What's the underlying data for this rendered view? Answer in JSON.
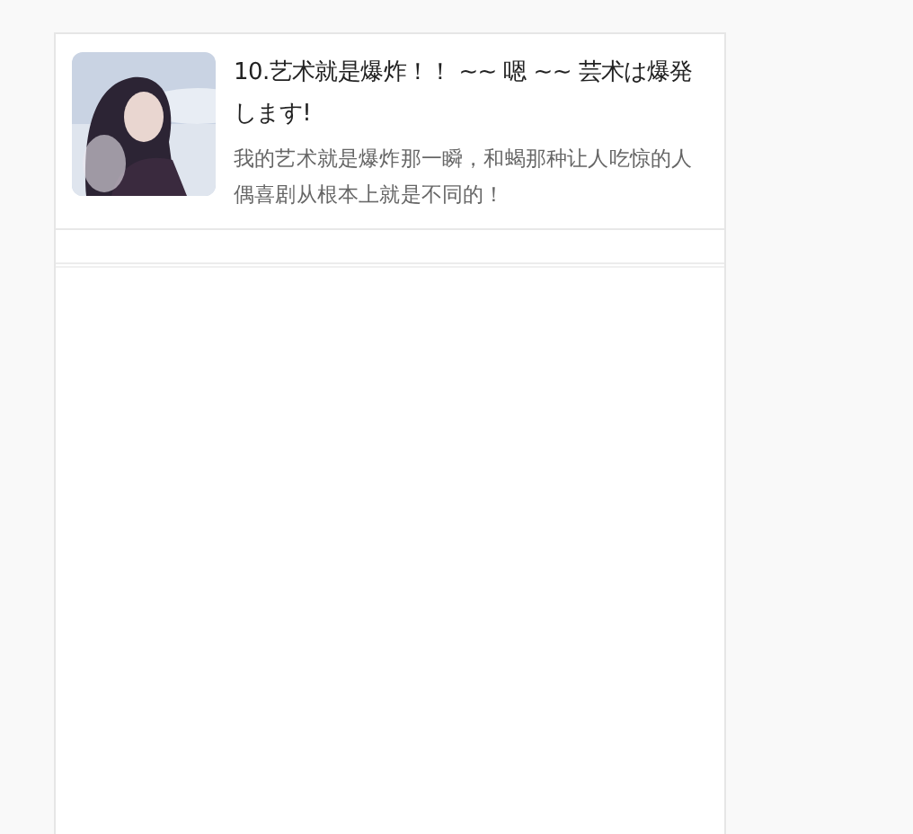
{
  "card": {
    "title": "10.艺术就是爆炸！！ ~~ 嗯 ~~ 芸术は爆発します!",
    "description": "我的艺术就是爆炸那一瞬，和蝎那种让人吃惊的人偶喜剧从根本上就是不同的！"
  }
}
